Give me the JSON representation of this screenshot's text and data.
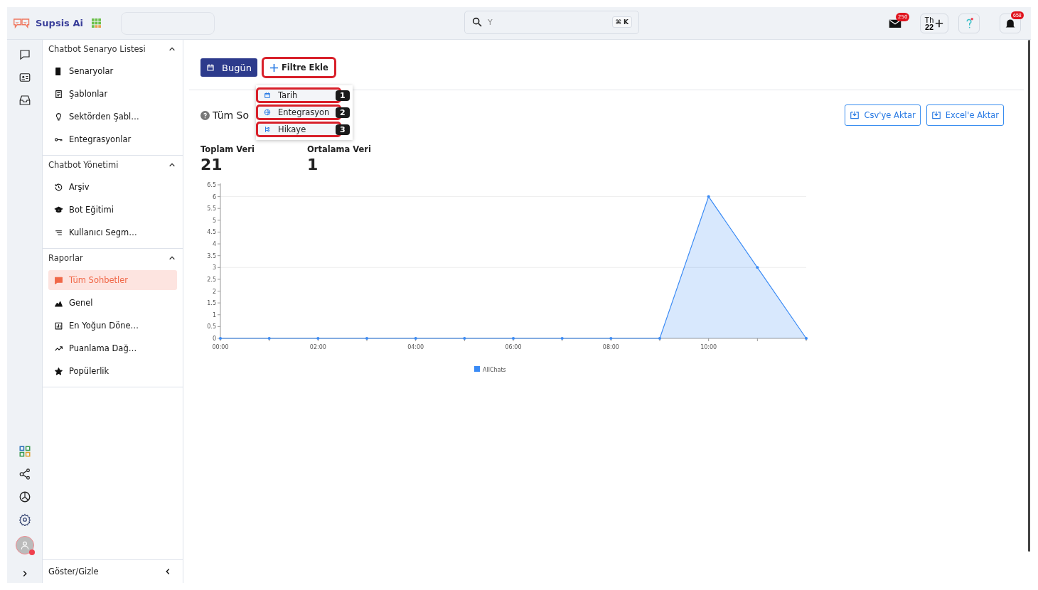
{
  "brand": {
    "name": "Supsis Ai"
  },
  "search": {
    "placeholder": "Y",
    "shortcut": "⌘ K"
  },
  "header_actions": {
    "mail_badge": "250",
    "calendar_label": "Th",
    "calendar_day": "22",
    "notification_badge": "658"
  },
  "sidebar": {
    "sections": [
      {
        "title": "Chatbot Senaryo Listesi",
        "expanded": true,
        "items": [
          {
            "label": "Senaryolar",
            "selected": false
          },
          {
            "label": "Şablonlar",
            "selected": false
          },
          {
            "label": "Sektörden Şabl…",
            "selected": false
          },
          {
            "label": "Entegrasyonlar",
            "selected": false
          }
        ]
      },
      {
        "title": "Chatbot Yönetimi",
        "expanded": true,
        "items": [
          {
            "label": "Arşiv",
            "selected": false
          },
          {
            "label": "Bot Eğitimi",
            "selected": false
          },
          {
            "label": "Kullanıcı Segm…",
            "selected": false
          }
        ]
      },
      {
        "title": "Raporlar",
        "expanded": true,
        "items": [
          {
            "label": "Tüm Sohbetler",
            "selected": true
          },
          {
            "label": "Genel",
            "selected": false
          },
          {
            "label": "En Yoğun Döne…",
            "selected": false
          },
          {
            "label": "Puanlama Dağ…",
            "selected": false
          },
          {
            "label": "Popülerlik",
            "selected": false
          }
        ]
      }
    ],
    "footer": "Göster/Gizle"
  },
  "toolbar": {
    "today_button": "Bugün",
    "filter_button": {
      "label": "Filtre Ekle",
      "highlighted": true
    }
  },
  "filter_menu": {
    "items": [
      {
        "label": "Tarih",
        "step": "1",
        "highlighted": true
      },
      {
        "label": "Entegrasyon",
        "step": "2",
        "highlighted": true
      },
      {
        "label": "Hikaye",
        "step": "3",
        "highlighted": true
      }
    ]
  },
  "report": {
    "title": "Tüm So",
    "export_buttons": [
      "Csv'ye Aktar",
      "Excel'e Aktar"
    ],
    "stats": [
      {
        "label": "Toplam Veri",
        "value": "21"
      },
      {
        "label": "Ortalama Veri",
        "value": "1"
      }
    ],
    "chart_data": {
      "type": "area",
      "x": [
        0,
        1,
        2,
        3,
        4,
        5,
        6,
        7,
        8,
        9,
        10,
        11,
        12
      ],
      "series": [
        {
          "name": "AllChats",
          "color": "#3b8bf5",
          "values": [
            0,
            0,
            0,
            0,
            0,
            0,
            0,
            0,
            0,
            0,
            6,
            3,
            0
          ]
        }
      ],
      "xlim": [
        0,
        12
      ],
      "ylim": [
        0,
        6.5
      ],
      "yticks": [
        0,
        0.5,
        1,
        1.5,
        2,
        2.5,
        3,
        3.5,
        4,
        4.5,
        5,
        5.5,
        6,
        6.5
      ],
      "xticks": [
        {
          "value": 0,
          "label": "00:00"
        },
        {
          "value": 2,
          "label": "02:00"
        },
        {
          "value": 4,
          "label": "04:00"
        },
        {
          "value": 6,
          "label": "06:00"
        },
        {
          "value": 8,
          "label": "08:00"
        },
        {
          "value": 10,
          "label": "10:00"
        }
      ]
    }
  }
}
